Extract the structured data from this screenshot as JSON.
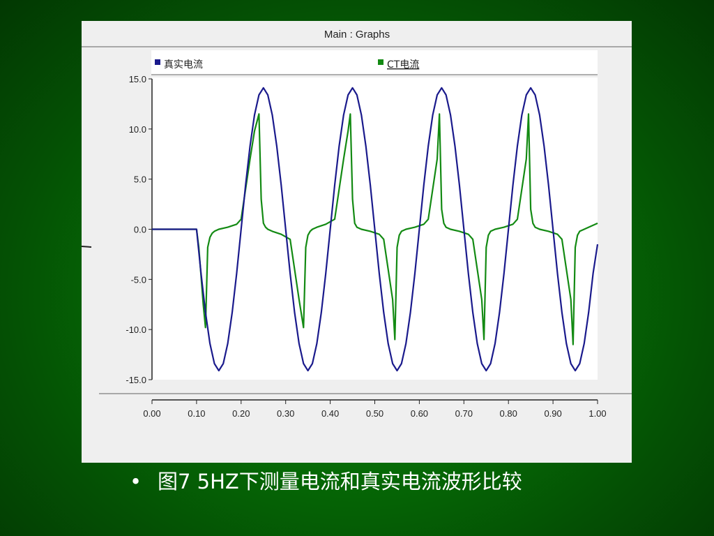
{
  "caption": {
    "bullet": "•",
    "text": "图7  5HZ下测量电流和真实电流波形比较"
  },
  "colors": {
    "background": "#067006",
    "panel": "#efefef",
    "plot": "#ffffff",
    "series_real": "#1a1a8c",
    "series_ct": "#138a13"
  },
  "chart_data": {
    "type": "line",
    "title": "Main : Graphs",
    "xlabel": "",
    "ylabel": "",
    "xlim": [
      0.0,
      1.0
    ],
    "ylim": [
      -15.0,
      15.0
    ],
    "x_ticks": [
      "0.00",
      "0.10",
      "0.20",
      "0.30",
      "0.40",
      "0.50",
      "0.60",
      "0.70",
      "0.80",
      "0.90",
      "1.00"
    ],
    "y_ticks": [
      "15.0",
      "10.0",
      "5.0",
      "0.0",
      "-5.0",
      "-10.0",
      "-15.0"
    ],
    "legend_position": "top",
    "grid": false,
    "series": [
      {
        "name": "真实电流",
        "color": "#1a1a8c",
        "x": [
          0.0,
          0.1,
          0.11,
          0.12,
          0.13,
          0.14,
          0.15,
          0.16,
          0.17,
          0.18,
          0.19,
          0.2,
          0.21,
          0.22,
          0.23,
          0.24,
          0.25,
          0.26,
          0.27,
          0.28,
          0.29,
          0.3,
          0.31,
          0.32,
          0.33,
          0.34,
          0.35,
          0.36,
          0.37,
          0.38,
          0.39,
          0.4,
          0.41,
          0.42,
          0.43,
          0.44,
          0.45,
          0.46,
          0.47,
          0.48,
          0.49,
          0.5,
          0.51,
          0.52,
          0.53,
          0.54,
          0.55,
          0.56,
          0.57,
          0.58,
          0.59,
          0.6,
          0.61,
          0.62,
          0.63,
          0.64,
          0.65,
          0.66,
          0.67,
          0.68,
          0.69,
          0.7,
          0.71,
          0.72,
          0.73,
          0.74,
          0.75,
          0.76,
          0.77,
          0.78,
          0.79,
          0.8,
          0.81,
          0.82,
          0.83,
          0.84,
          0.85,
          0.86,
          0.87,
          0.88,
          0.89,
          0.9,
          0.91,
          0.92,
          0.93,
          0.94,
          0.95,
          0.96,
          0.97,
          0.98,
          0.99,
          1.0
        ],
        "y": [
          0.0,
          0.0,
          -4.4,
          -8.3,
          -11.4,
          -13.4,
          -14.1,
          -13.4,
          -11.4,
          -8.3,
          -4.4,
          0.0,
          4.4,
          8.3,
          11.4,
          13.4,
          14.1,
          13.4,
          11.4,
          8.3,
          4.4,
          0.0,
          -4.4,
          -8.3,
          -11.4,
          -13.4,
          -14.1,
          -13.4,
          -11.4,
          -8.3,
          -4.4,
          0.0,
          4.4,
          8.3,
          11.4,
          13.4,
          14.1,
          13.4,
          11.4,
          8.3,
          4.4,
          0.0,
          -4.4,
          -8.3,
          -11.4,
          -13.4,
          -14.1,
          -13.4,
          -11.4,
          -8.3,
          -4.4,
          0.0,
          4.4,
          8.3,
          11.4,
          13.4,
          14.1,
          13.4,
          11.4,
          8.3,
          4.4,
          0.0,
          -4.4,
          -8.3,
          -11.4,
          -13.4,
          -14.1,
          -13.4,
          -11.4,
          -8.3,
          -4.4,
          0.0,
          4.4,
          8.3,
          11.4,
          13.4,
          14.1,
          13.4,
          11.4,
          8.3,
          4.4,
          0.0,
          -4.4,
          -8.3,
          -11.4,
          -13.4,
          -14.1,
          -13.4,
          -11.4,
          -8.3,
          -4.4,
          -1.5
        ]
      },
      {
        "name": "CT电流",
        "color": "#138a13",
        "x": [
          0.0,
          0.1,
          0.105,
          0.11,
          0.115,
          0.12,
          0.125,
          0.13,
          0.135,
          0.14,
          0.15,
          0.17,
          0.19,
          0.2,
          0.21,
          0.22,
          0.23,
          0.24,
          0.245,
          0.25,
          0.255,
          0.26,
          0.27,
          0.29,
          0.31,
          0.32,
          0.33,
          0.34,
          0.345,
          0.35,
          0.355,
          0.36,
          0.37,
          0.39,
          0.41,
          0.42,
          0.43,
          0.44,
          0.445,
          0.45,
          0.455,
          0.46,
          0.47,
          0.49,
          0.51,
          0.52,
          0.53,
          0.54,
          0.545,
          0.55,
          0.555,
          0.56,
          0.57,
          0.59,
          0.61,
          0.62,
          0.63,
          0.64,
          0.645,
          0.65,
          0.655,
          0.66,
          0.67,
          0.69,
          0.71,
          0.72,
          0.73,
          0.74,
          0.745,
          0.75,
          0.755,
          0.76,
          0.77,
          0.79,
          0.81,
          0.82,
          0.83,
          0.84,
          0.845,
          0.85,
          0.855,
          0.86,
          0.87,
          0.89,
          0.91,
          0.92,
          0.93,
          0.94,
          0.945,
          0.95,
          0.955,
          0.96,
          0.97,
          1.0
        ],
        "y": [
          0.0,
          0.0,
          -1.8,
          -4.6,
          -7.5,
          -9.8,
          -1.8,
          -0.8,
          -0.4,
          -0.2,
          0.0,
          0.2,
          0.5,
          1.0,
          4.0,
          7.0,
          9.8,
          11.5,
          3.0,
          0.6,
          0.2,
          0.0,
          -0.2,
          -0.5,
          -1.0,
          -4.0,
          -7.0,
          -9.8,
          -1.8,
          -0.6,
          -0.2,
          0.0,
          0.2,
          0.5,
          1.0,
          4.0,
          7.0,
          9.8,
          11.5,
          3.0,
          0.6,
          0.2,
          0.0,
          -0.2,
          -0.5,
          -1.0,
          -4.0,
          -7.0,
          -11.0,
          -1.8,
          -0.6,
          -0.2,
          0.0,
          0.2,
          0.5,
          1.0,
          4.0,
          7.0,
          11.5,
          2.0,
          0.6,
          0.2,
          0.0,
          -0.2,
          -0.5,
          -1.0,
          -4.0,
          -7.0,
          -11.0,
          -1.8,
          -0.6,
          -0.2,
          0.0,
          0.2,
          0.5,
          1.0,
          4.0,
          7.0,
          11.5,
          2.0,
          0.6,
          0.2,
          0.0,
          -0.2,
          -0.5,
          -1.0,
          -4.0,
          -7.0,
          -11.5,
          -1.8,
          -0.6,
          -0.2,
          0.0,
          0.6
        ]
      }
    ]
  }
}
